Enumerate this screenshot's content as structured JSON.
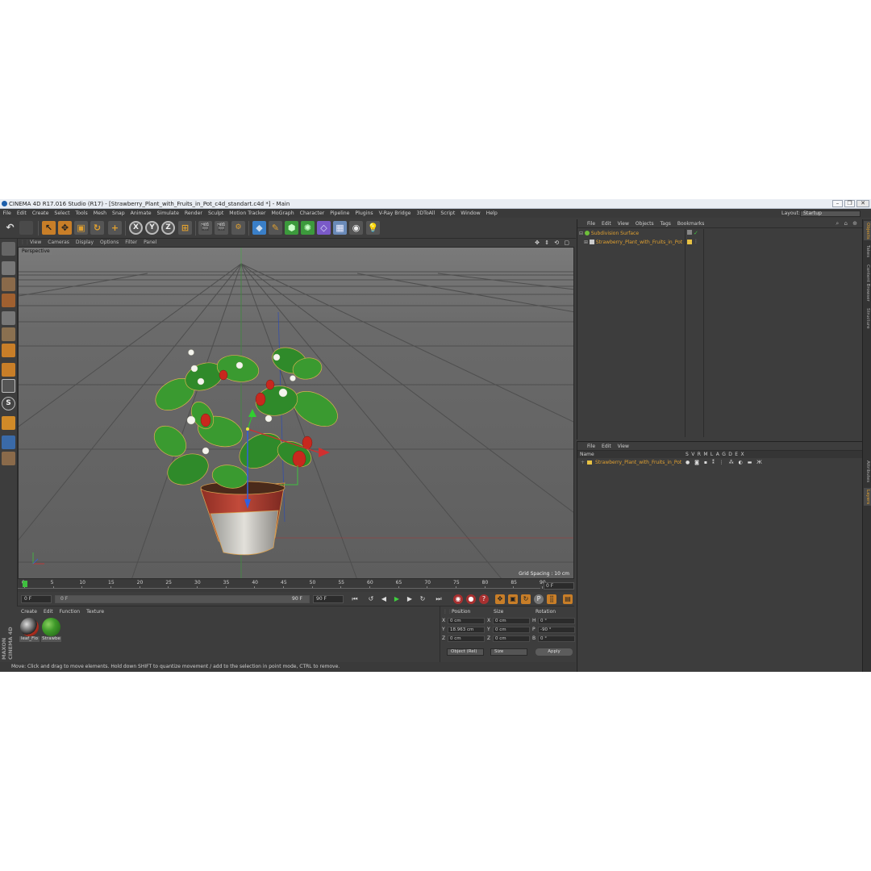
{
  "window": {
    "title": "CINEMA 4D R17.016 Studio (R17) - [Strawberry_Plant_with_Fruits_in_Pot_c4d_standart.c4d *] - Main",
    "buttons": [
      "–",
      "❐",
      "✕"
    ]
  },
  "menubar": {
    "items": [
      "File",
      "Edit",
      "Create",
      "Select",
      "Tools",
      "Mesh",
      "Snap",
      "Animate",
      "Simulate",
      "Render",
      "Sculpt",
      "Motion Tracker",
      "MoGraph",
      "Character",
      "Pipeline",
      "Plugins",
      "V-Ray Bridge",
      "3DToAll",
      "Script",
      "Window",
      "Help"
    ],
    "layout_label": "Layout:",
    "layout_value": "Startup"
  },
  "toolbar": {
    "axis_x": "X",
    "axis_y": "Y",
    "axis_z": "Z"
  },
  "viewport": {
    "menu": [
      "View",
      "Cameras",
      "Display",
      "Options",
      "Filter",
      "Panel"
    ],
    "nav_icons": "✥ ⇕ ⟲ ▢",
    "camera_label": "Perspective",
    "grid_spacing": "Grid Spacing : 10 cm"
  },
  "timeline": {
    "ticks": [
      "0",
      "5",
      "10",
      "15",
      "20",
      "25",
      "30",
      "35",
      "40",
      "45",
      "50",
      "55",
      "60",
      "65",
      "70",
      "75",
      "80",
      "85",
      "90"
    ],
    "current_frame": "0 F"
  },
  "transport": {
    "start_frame": "0 F",
    "range_start": "0 F",
    "range_end": "90 F",
    "end_frame": "90 F"
  },
  "materials": {
    "menu": [
      "Create",
      "Edit",
      "Function",
      "Texture"
    ],
    "brand_top": "MAXON",
    "brand_bottom": "CINEMA 4D",
    "items": [
      {
        "name": "leaf_Flo",
        "color": "#c23a2a"
      },
      {
        "name": "Strawbe",
        "color": "#3f9a2a"
      }
    ]
  },
  "coordinates": {
    "headers": [
      "Position",
      "Size",
      "Rotation"
    ],
    "rows": [
      {
        "pos_axis": "X",
        "pos": "0 cm",
        "size_axis": "X",
        "size": "0 cm",
        "rot_axis": "H",
        "rot": "0 °"
      },
      {
        "pos_axis": "Y",
        "pos": "18.963 cm",
        "size_axis": "Y",
        "size": "0 cm",
        "rot_axis": "P",
        "rot": "-90 °"
      },
      {
        "pos_axis": "Z",
        "pos": "0 cm",
        "size_axis": "Z",
        "size": "0 cm",
        "rot_axis": "B",
        "rot": "0 °"
      }
    ],
    "mode": "Object (Rel)",
    "size_mode": "Size",
    "apply": "Apply"
  },
  "status": "Move: Click and drag to move elements. Hold down SHIFT to quantize movement / add to the selection in point mode, CTRL to remove.",
  "objects": {
    "menu": [
      "File",
      "Edit",
      "View",
      "Objects",
      "Tags",
      "Bookmarks"
    ],
    "rows": [
      {
        "name": "Subdivision Surface",
        "color": "#6fbf3a"
      },
      {
        "name": "Strawberry_Plant_with_Fruits_in_Pot",
        "color": "#e8c244"
      }
    ]
  },
  "layers": {
    "menu": [
      "File",
      "Edit",
      "View"
    ],
    "header_name": "Name",
    "header_cols": [
      "S",
      "V",
      "R",
      "M",
      "L",
      "A",
      "G",
      "D",
      "E",
      "X"
    ],
    "rows": [
      {
        "name": "Strawberry_Plant_with_Fruits_in_Pot",
        "color": "#e8c244"
      }
    ]
  },
  "right_tabs": [
    "Objects",
    "Takes",
    "Content Browser",
    "Structure",
    "Attributes",
    "Layers"
  ],
  "colors": {
    "accent_orange": "#e0a030",
    "viewport_bg": "#616161",
    "panel_bg": "#3d3d3d"
  }
}
